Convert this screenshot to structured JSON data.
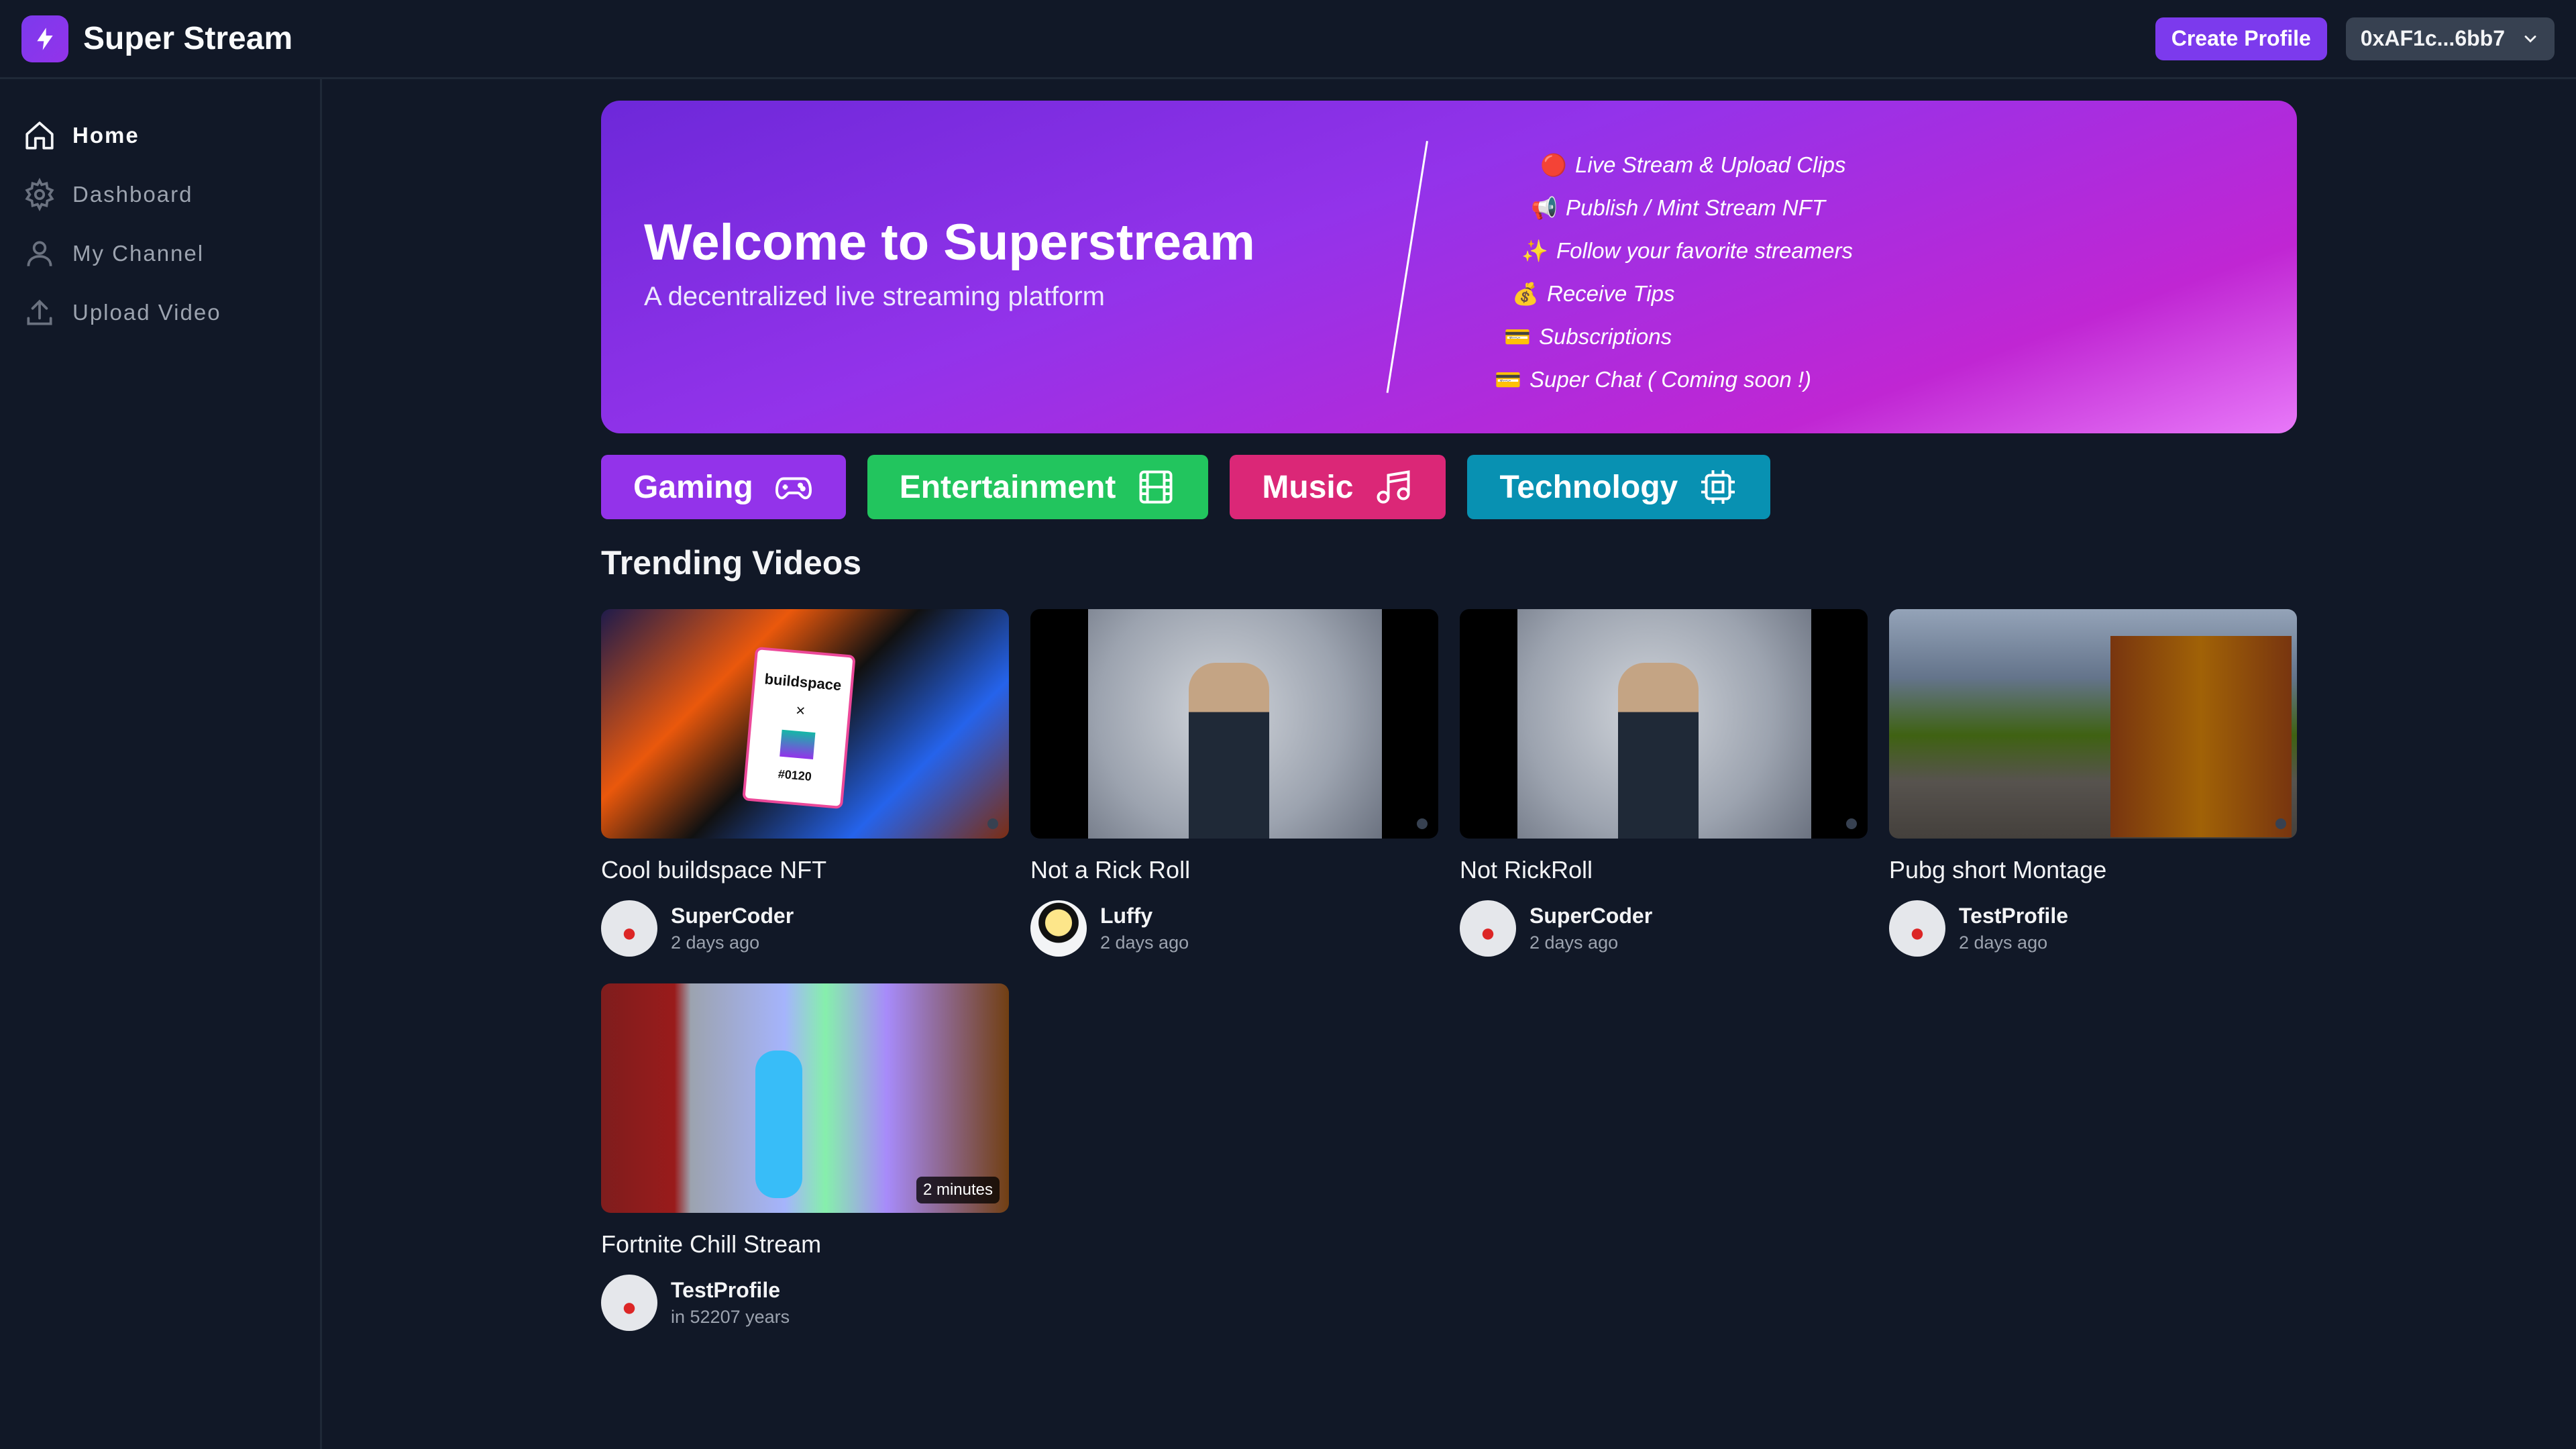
{
  "app": {
    "name": "Super Stream"
  },
  "header": {
    "create_profile": "Create Profile",
    "wallet": "0xAF1c...6bb7"
  },
  "sidebar": {
    "items": [
      {
        "label": "Home",
        "icon": "home-icon",
        "active": true
      },
      {
        "label": "Dashboard",
        "icon": "gear-icon",
        "active": false
      },
      {
        "label": "My Channel",
        "icon": "user-icon",
        "active": false
      },
      {
        "label": "Upload Video",
        "icon": "upload-icon",
        "active": false
      }
    ]
  },
  "hero": {
    "title": "Welcome to Superstream",
    "subtitle": "A decentralized live streaming platform",
    "features": [
      {
        "emoji": "🔴",
        "text": "Live Stream & Upload Clips"
      },
      {
        "emoji": "📢",
        "text": "Publish / Mint Stream NFT"
      },
      {
        "emoji": "✨",
        "text": "Follow your favorite streamers"
      },
      {
        "emoji": "💰",
        "text": "Receive Tips"
      },
      {
        "emoji": "💳",
        "text": "Subscriptions"
      },
      {
        "emoji": "💳",
        "text": "Super Chat ( Coming soon !)"
      }
    ]
  },
  "categories": [
    {
      "label": "Gaming",
      "color": "#9333ea",
      "icon": "gamepad-icon"
    },
    {
      "label": "Entertainment",
      "color": "#22c55e",
      "icon": "film-icon"
    },
    {
      "label": "Music",
      "color": "#db2777",
      "icon": "music-icon"
    },
    {
      "label": "Technology",
      "color": "#0891b2",
      "icon": "cpu-icon"
    }
  ],
  "trending": {
    "title": "Trending Videos",
    "videos": [
      {
        "title": "Cool buildspace NFT",
        "author": "SuperCoder",
        "time": "2 days ago",
        "duration": "",
        "thumb_text": "buildspace",
        "thumb_sub": "#0120"
      },
      {
        "title": "Not a Rick Roll",
        "author": "Luffy",
        "time": "2 days ago",
        "duration": ""
      },
      {
        "title": "Not RickRoll",
        "author": "SuperCoder",
        "time": "2 days ago",
        "duration": ""
      },
      {
        "title": "Pubg short Montage",
        "author": "TestProfile",
        "time": "2 days ago",
        "duration": ""
      },
      {
        "title": "Fortnite Chill Stream",
        "author": "TestProfile",
        "time": "in 52207 years",
        "duration": "2 minutes"
      }
    ]
  }
}
